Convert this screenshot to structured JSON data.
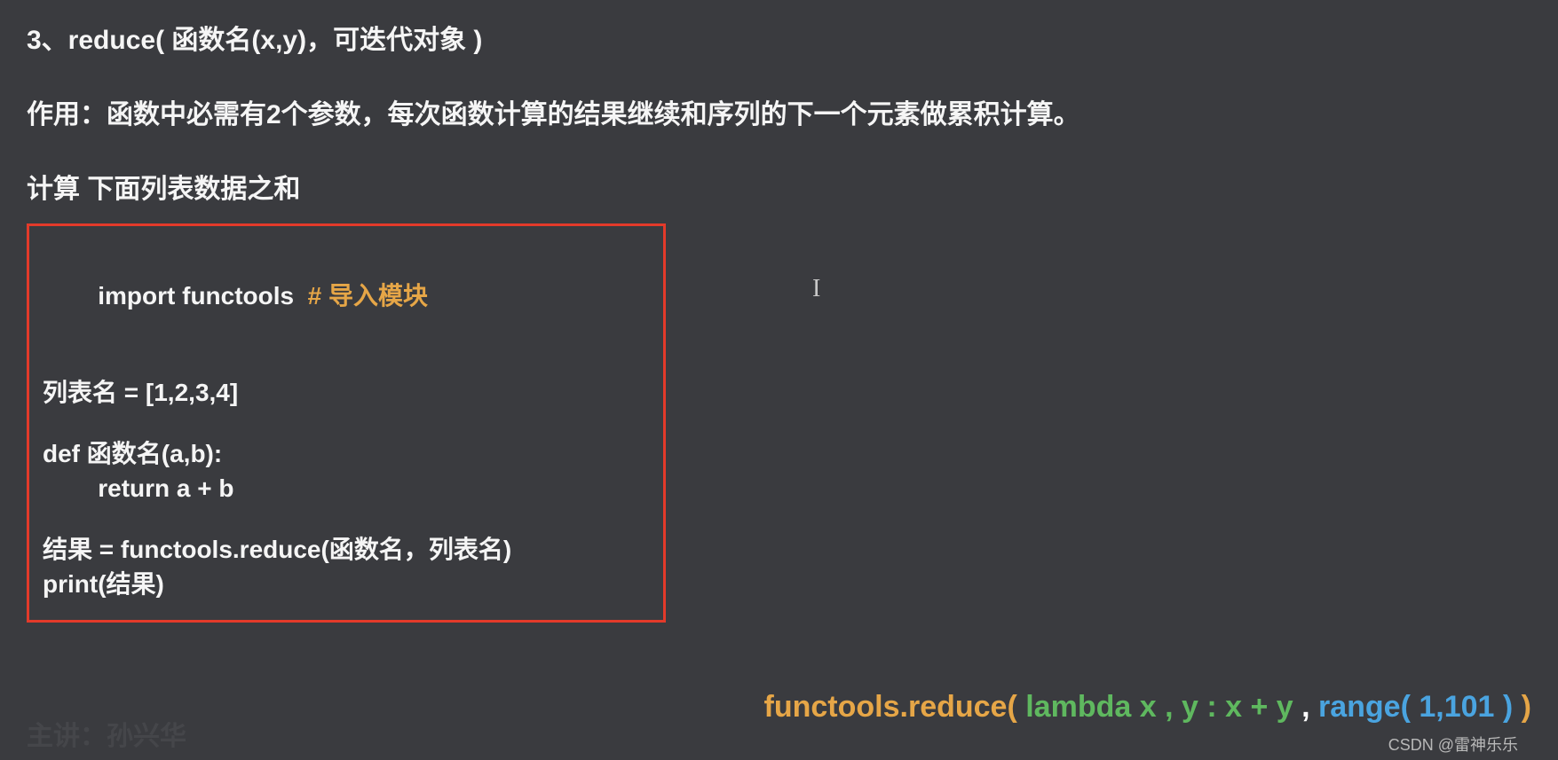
{
  "heading": "3、reduce( 函数名(x,y)，可迭代对象 )",
  "description": "作用：函数中必需有2个参数，每次函数计算的结果继续和序列的下一个元素做累积计算。",
  "subtitle": "计算  下面列表数据之和",
  "code": {
    "import_stmt": "import functools",
    "import_comment": "  # 导入模块",
    "list_assign": "列表名 = [1,2,3,4]",
    "def_line": "def 函数名(a,b):",
    "return_line": "        return a + b",
    "result_line": "结果 = functools.reduce(函数名，列表名)",
    "print_line": "print(结果)"
  },
  "bottom": {
    "prefix": "functools.reduce( ",
    "lambda": "lambda x , y : x + y",
    "sep": " , ",
    "range": "range( 1,101 )",
    "suffix": " )"
  },
  "dim_author": "主讲：孙兴华",
  "watermark": "CSDN @雷神乐乐",
  "cursor_char": "I"
}
